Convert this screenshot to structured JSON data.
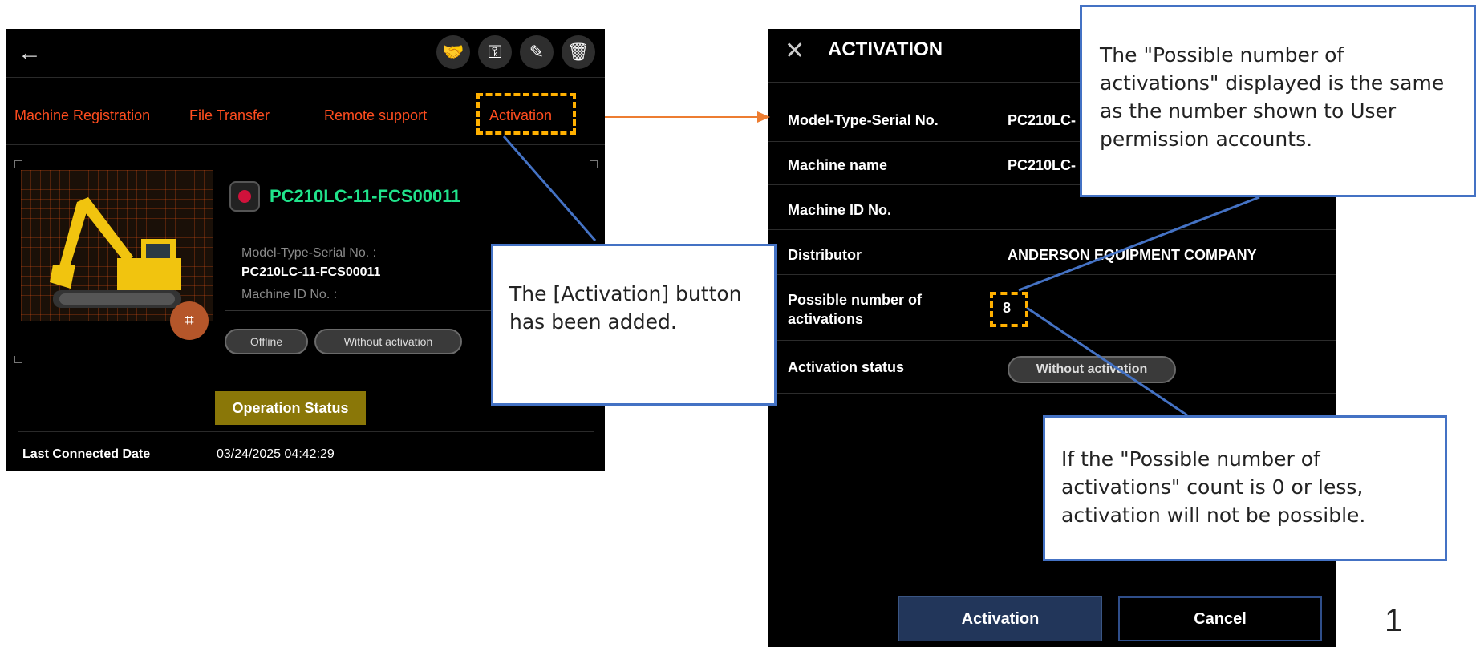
{
  "left_screen": {
    "back_icon": "arrow-left-icon",
    "actions": [
      "handshake-icon",
      "hand-key-icon",
      "pencil-icon",
      "trash-icon"
    ],
    "tabs": [
      "Machine Registration",
      "File Transfer",
      "Remote support",
      "Activation"
    ],
    "machine_title": "PC210LC-11-FCS00011",
    "model_label": "Model-Type-Serial No. :",
    "model_value": "PC210LC-11-FCS00011",
    "machine_id_label": "Machine ID No. :",
    "status_pills": [
      "Offline",
      "Without activation"
    ],
    "operation_status": "Operation Status",
    "last_connected_label": "Last Connected Date",
    "last_connected_value": "03/24/2025 04:42:29",
    "accent_color": "#ff4d1f",
    "title_color": "#20e38b"
  },
  "right_screen": {
    "title": "ACTIVATION",
    "rows": [
      {
        "label": "Model-Type-Serial No.",
        "value": "PC210LC-"
      },
      {
        "label": "Machine name",
        "value": "PC210LC-"
      },
      {
        "label": "Machine ID No.",
        "value": ""
      },
      {
        "label": "Distributor",
        "value": "ANDERSON EQUIPMENT COMPANY"
      },
      {
        "label": "Possible number of activations",
        "value": "8"
      },
      {
        "label": "Activation status",
        "value": "Without activation"
      }
    ],
    "possible_label_line1": "Possible number of",
    "possible_label_line2": "activations",
    "activation_button": "Activation",
    "cancel_button": "Cancel"
  },
  "callouts": {
    "activation_added": "The [Activation] button has been added.",
    "possible_number": "The \"Possible number of activations\" displayed is the same as the number shown to User permission accounts.",
    "zero_or_less": "If the \"Possible number of activations\" count is 0 or less, activation will not be possible."
  },
  "page_number": "1",
  "colors": {
    "highlight": "#ffb000",
    "callout_border": "#4472c4",
    "arrow": "#ed7d31"
  }
}
